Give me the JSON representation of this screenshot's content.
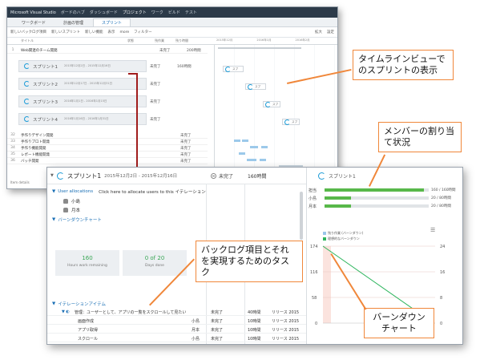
{
  "back_window": {
    "titlebar": {
      "app_title": "Microsoft Visual Studio",
      "tabs": [
        "ボードのハブ",
        "ダッシュボード",
        "プロジェクト",
        "ワーク",
        "ビルド",
        "テスト"
      ]
    },
    "tabs": [
      "ワークボード",
      "計画の管理",
      "スプリント"
    ],
    "toolbar": {
      "items": [
        "新しいバックログ項目",
        "新しいスプリント",
        "新しい機能",
        "表示",
        "more",
        "フィルター"
      ],
      "right": [
        "拡大",
        "設定"
      ]
    },
    "grid_header": [
      "タイトル",
      "状態",
      "残作業",
      "残り時間"
    ],
    "rows": [
      {
        "num": "1",
        "name": "Web関連のチーム開発",
        "status": "未完了",
        "hours": "200時間"
      },
      {
        "num": "32",
        "name": "手作りデザイン開発",
        "status": "未完了",
        "hours": ""
      },
      {
        "num": "33",
        "name": "手作りプロト開発",
        "status": "未完了",
        "hours": ""
      },
      {
        "num": "34",
        "name": "手作り機能開発",
        "status": "未完了",
        "hours": ""
      },
      {
        "num": "35",
        "name": "レポート機能開発",
        "status": "未完了",
        "hours": ""
      },
      {
        "num": "36",
        "name": "バッチ開発",
        "status": "未完了",
        "hours": ""
      }
    ],
    "sprints": [
      {
        "name": "スプリント1",
        "dates": "2015年12月2日 - 2015年12月16日",
        "status": "未完了",
        "hours": "160時間"
      },
      {
        "name": "スプリント2",
        "dates": "2015年12月17日 - 2015年12月31日",
        "status": "未完了",
        "hours": ""
      },
      {
        "name": "スプリント3",
        "dates": "2016年1月1日 - 2016年1月15日",
        "status": "未完了",
        "hours": ""
      },
      {
        "name": "スプリント4",
        "dates": "2016年1月16日 - 2016年1月31日",
        "status": "未完了",
        "hours": ""
      }
    ],
    "timeline_months": [
      "2015年12月",
      "2016年1月",
      "2016年2月"
    ],
    "timeline_bar_labels": [
      "スプ",
      "スプ",
      "スプ",
      "スプ"
    ],
    "footer": "Item details"
  },
  "front_window": {
    "sprint": {
      "name": "スプリント1",
      "dates": "2015年12月2日 - 2015年12月16日",
      "status": "未完了",
      "hours": "160時間"
    },
    "allocation": {
      "title": "User allocations",
      "hint": "Click here to allocate users to this イテレーション"
    },
    "members": [
      "小島",
      "月本"
    ],
    "burndown_section": "バーンダウンチャート",
    "tiles": [
      {
        "value": "160",
        "label": "Hours work remaining"
      },
      {
        "value": "0 of 20",
        "label": "Days done"
      }
    ],
    "iteration_section": "イテレーションアイテム",
    "items": [
      {
        "title": "管理：ユーザーとして、アプリの一覧をスクロールして見たい",
        "owner": "",
        "status": "未完了",
        "hours": "40時間",
        "release": "リリース 2015"
      },
      {
        "title": "画面作成",
        "owner": "小島",
        "status": "未完了",
        "hours": "10時間",
        "release": "リリース 2015"
      },
      {
        "title": "アプリ取得",
        "owner": "月本",
        "status": "未完了",
        "hours": "10時間",
        "release": "リリース 2015"
      },
      {
        "title": "スクロール",
        "owner": "小島",
        "status": "未完了",
        "hours": "10時間",
        "release": "リリース 2015"
      }
    ],
    "right_panel": {
      "title": "スプリント1",
      "member_bars": [
        {
          "name": "担当",
          "value": "160 / 160時間",
          "fraction": 0.95
        },
        {
          "name": "小島",
          "value": "20 / 80時間",
          "fraction": 0.25
        },
        {
          "name": "月本",
          "value": "20 / 80時間",
          "fraction": 0.25
        }
      ],
      "legend": [
        "残り作業 (バーンダウン)",
        "理想的なバーンダウン"
      ],
      "y_ticks": [
        "174",
        "116",
        "58",
        "0"
      ],
      "y2_ticks": [
        "24",
        "16",
        "8",
        "0"
      ]
    }
  },
  "callouts": {
    "timeline": "タイムラインビューでのスプリントの表示",
    "members": "メンバーの割り当て状況",
    "backlog": "バックログ項目とそれを実現するためのタスク",
    "burndown": "バーンダウンチャート"
  },
  "colors": {
    "accent_blue": "#1a9bd7",
    "callout_border": "#f0873a",
    "progress_green": "#58b84a",
    "connector_red": "#a01c1c",
    "tile_value_green": "#3aa756",
    "burndown_line": "#2db55d"
  }
}
